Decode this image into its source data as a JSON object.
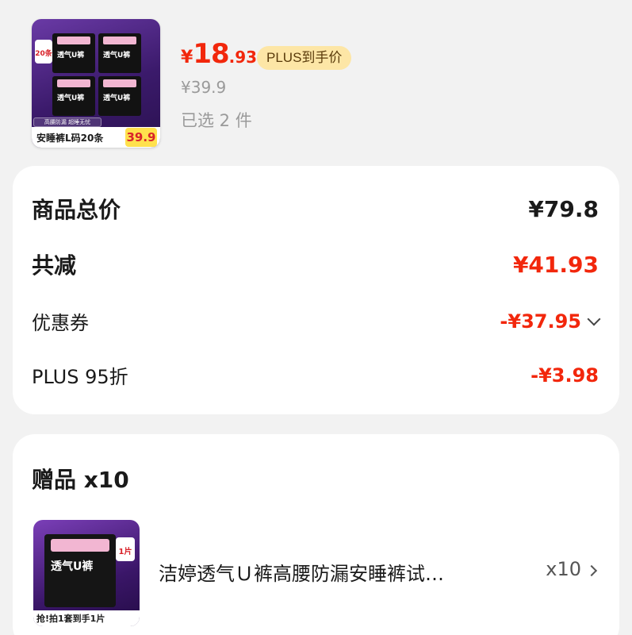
{
  "product": {
    "thumb_image_label": "安睡裤L码20条",
    "thumb_price": "39.9",
    "thumb_badge": "20条",
    "thumb_pack_label": "透气U裤",
    "thumb_tag": "高腰防漏 超睡无忧",
    "price_symbol": "¥",
    "price_integer": "18",
    "price_decimal": ".93",
    "plus_badge": "PLUS到手价",
    "original_price": "¥39.9",
    "selected_count": "已选 2 件"
  },
  "totals": {
    "goods_total_label": "商品总价",
    "goods_total_value": "¥79.8",
    "reduction_label": "共减",
    "reduction_value": "¥41.93",
    "coupon_label": "优惠券",
    "coupon_value": "-¥37.95",
    "plus_discount_label": "PLUS 95折",
    "plus_discount_value": "-¥3.98"
  },
  "gift": {
    "title": "赠品 x10",
    "thumb_pack_label": "透气U裤",
    "thumb_badge": "1片",
    "thumb_strip": "抢!拍1套到手1片",
    "name": "洁婷透气Ｕ裤高腰防漏安睡裤试…",
    "quantity": "x10"
  },
  "colors": {
    "accent_red": "#f2270c",
    "plus_badge_bg": "#fde6a6",
    "muted_text": "#9a9a9a"
  }
}
